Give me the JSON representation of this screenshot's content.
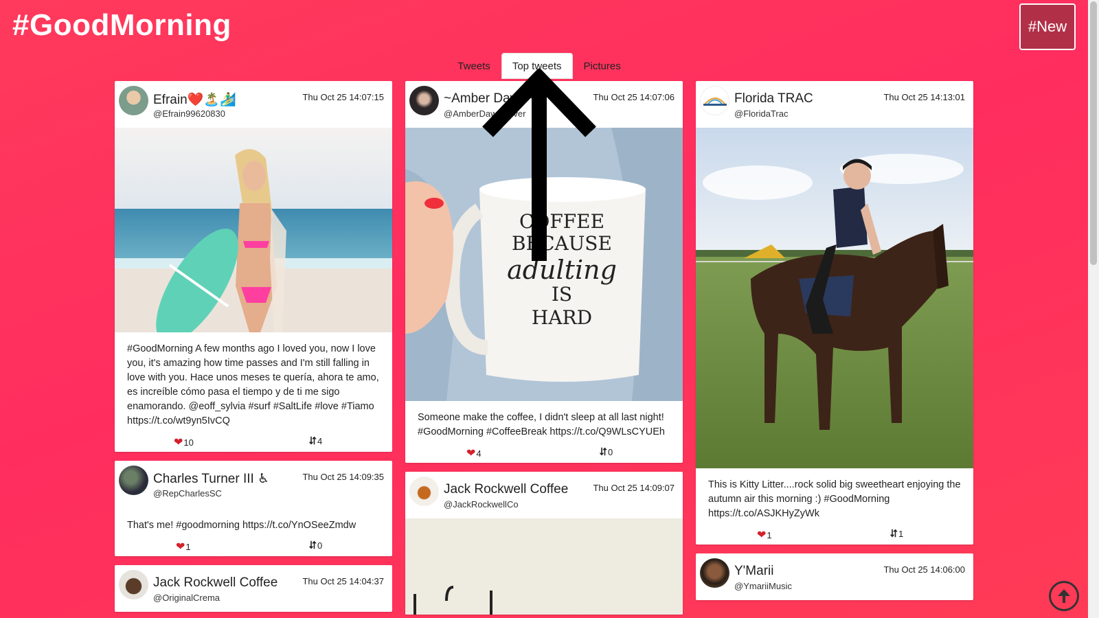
{
  "app": {
    "title": "#GoodMorning",
    "new_button": "#New"
  },
  "tabs": [
    {
      "label": "Tweets",
      "active": false
    },
    {
      "label": "Top tweets",
      "active": true
    },
    {
      "label": "Pictures",
      "active": false
    }
  ],
  "tweets": [
    {
      "name": "Efrain❤️🏝️🏄‍♂️",
      "handle": "@Efrain99620830",
      "time": "Thu Oct 25 14:07:15",
      "text": "#GoodMorning A few months ago I loved you, now I love you, it's amazing how time passes and I'm still falling in love with you. Hace unos meses te quería, ahora te amo, es increíble cómo pasa el tiempo y de ti me sigo enamorando. @eoff_sylvia #surf #SaltLife #love #Tiamo https://t.co/wt9yn5IvCQ",
      "likes": "10",
      "retweets": "4"
    },
    {
      "name": "~Amber Dawn~",
      "handle": "@AmberDawnslover",
      "time": "Thu Oct 25 14:07:06",
      "text": "Someone make the coffee, I didn't sleep at all last night! #GoodMorning #CoffeeBreak https://t.co/Q9WLsCYUEh",
      "likes": "4",
      "retweets": "0",
      "mug_text": [
        "COFFEE",
        "BECAUSE",
        "adulting",
        "IS",
        "HARD"
      ]
    },
    {
      "name": "Florida TRAC",
      "handle": "@FloridaTrac",
      "time": "Thu Oct 25 14:13:01",
      "text": "This is Kitty Litter....rock solid big sweetheart enjoying the autumn air this morning :) #GoodMorning https://t.co/ASJKHyZyWk",
      "likes": "1",
      "retweets": "1"
    },
    {
      "name": "Charles Turner III ♿",
      "handle": "@RepCharlesSC",
      "time": "Thu Oct 25 14:09:35",
      "text": "That's me! #goodmorning https://t.co/YnOSeeZmdw",
      "likes": "1",
      "retweets": "0"
    },
    {
      "name": "Jack Rockwell Coffee",
      "handle": "@JackRockwellCo",
      "time": "Thu Oct 25 14:09:07"
    },
    {
      "name": "Y'Marii",
      "handle": "@YmariiMusic",
      "time": "Thu Oct 25 14:06:00"
    },
    {
      "name": "Jack Rockwell Coffee",
      "handle": "@OriginalCrema",
      "time": "Thu Oct 25 14:04:37"
    }
  ],
  "icons": {
    "heart": "heart-icon",
    "retweet": "retweet-icon",
    "scroll_top": "arrow-up-circle-icon"
  },
  "colors": {
    "background": "#ff2d5e",
    "new_button": "#b22f48",
    "heart": "#d4202a"
  }
}
